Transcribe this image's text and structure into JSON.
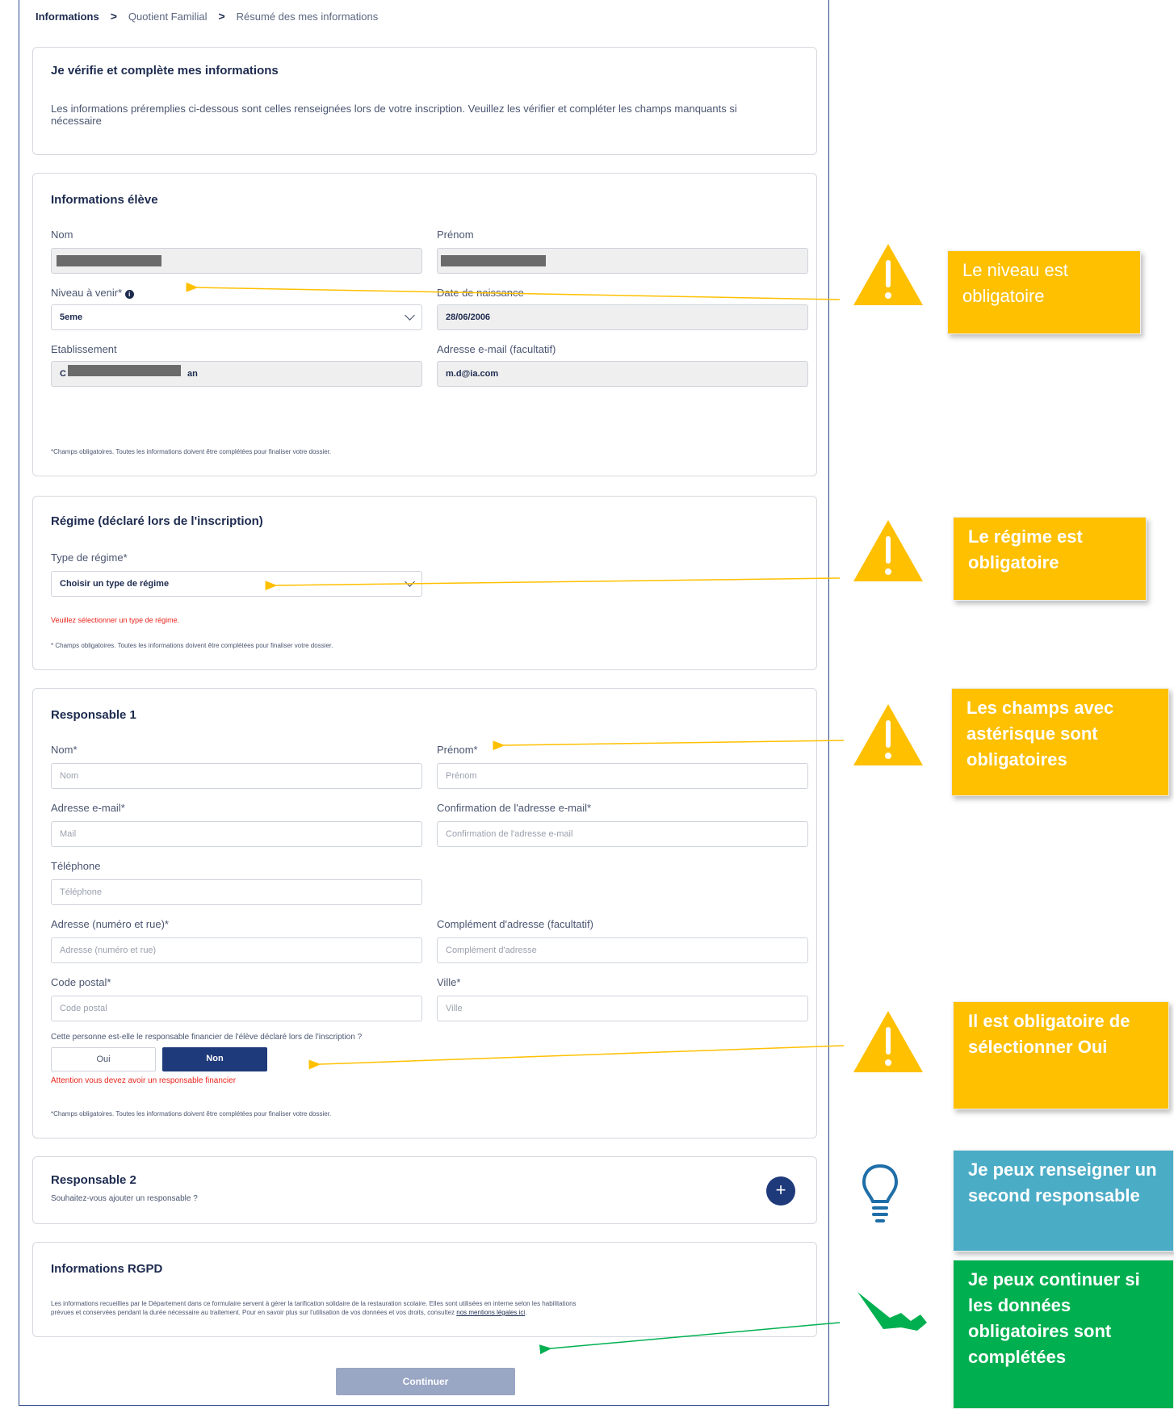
{
  "breadcrumb": {
    "step1": "Informations",
    "step2": "Quotient Familial",
    "step3": "Résumé des mes informations"
  },
  "intro": {
    "title": "Je vérifie et complète mes informations",
    "text": "Les informations préremplies ci-dessous sont celles renseignées lors de votre inscription. Veuillez les vérifier et compléter les champs manquants si nécessaire"
  },
  "eleve": {
    "title": "Informations élève",
    "nom_label": "Nom",
    "prenom_label": "Prénom",
    "niveau_label": "Niveau à venir*",
    "niveau_value": "5eme",
    "naissance_label": "Date de naissance",
    "naissance_value": "28/06/2006",
    "etab_label": "Etablissement",
    "etab_value_start": "C",
    "etab_value_end": "an",
    "email_label": "Adresse e-mail (facultatif)",
    "email_value": "m.d@ia.com",
    "note": "*Champs obligatoires. Toutes les informations doivent être complétées pour finaliser votre dossier."
  },
  "regime": {
    "title": "Régime (déclaré lors de l'inscription)",
    "type_label": "Type de régime*",
    "type_value": "Choisir un type de régime",
    "error": "Veuillez sélectionner un type de régime.",
    "note": "* Champs obligatoires. Toutes les informations doivent être complétées pour finaliser votre dossier."
  },
  "resp1": {
    "title": "Responsable 1",
    "nom_label": "Nom*",
    "nom_ph": "Nom",
    "prenom_label": "Prénom*",
    "prenom_ph": "Prénom",
    "email_label": "Adresse e-mail*",
    "email_ph": "Mail",
    "confirm_label": "Confirmation de l'adresse e-mail*",
    "confirm_ph": "Confirmation de l'adresse e-mail",
    "tel_label": "Téléphone",
    "tel_ph": "Téléphone",
    "adresse_label": "Adresse (numéro et rue)*",
    "adresse_ph": "Adresse (numéro et rue)",
    "complement_label": "Complément d'adresse (facultatif)",
    "complement_ph": "Complément d'adresse",
    "cp_label": "Code postal*",
    "cp_ph": "Code postal",
    "ville_label": "Ville*",
    "ville_ph": "Ville",
    "question": "Cette personne est-elle le responsable financier de l'élève déclaré lors de l'inscription ?",
    "oui": "Oui",
    "non": "Non",
    "error": "Attention vous devez avoir un responsable financier",
    "note": "*Champs obligatoires. Toutes les informations doivent être complétées pour finaliser votre dossier."
  },
  "resp2": {
    "title": "Responsable 2",
    "subtitle": "Souhaitez-vous ajouter un responsable ?",
    "add": "+"
  },
  "rgpd": {
    "title": "Informations RGPD",
    "text_a": "Les informations recueillies par le Département dans ce formulaire servent à gérer la tarification solidaire de la restauration scolaire. Elles sont utilisées en interne selon les habilitations",
    "text_b": "prévues et conservées pendant la durée nécessaire au traitement. Pour en savoir plus sur l'utilisation de vos données et vos droits, consultez ",
    "link": "nos mentions légales ici",
    "text_c": "."
  },
  "continue_label": "Continuer",
  "callouts": {
    "c1": "Le niveau est obligatoire",
    "c2": "Le régime est obligatoire",
    "c3": "Les champs avec astérisque sont obligatoires",
    "c4": "Il est obligatoire de sélectionner Oui",
    "c5": "Je peux renseigner un second responsable",
    "c6": "Je peux continuer si les données obligatoires sont complétées"
  },
  "colors": {
    "navy": "#1f3a7a",
    "yellow": "#ffc000",
    "blue": "#4bacc6",
    "green": "#00b050",
    "red": "#e8241c"
  }
}
